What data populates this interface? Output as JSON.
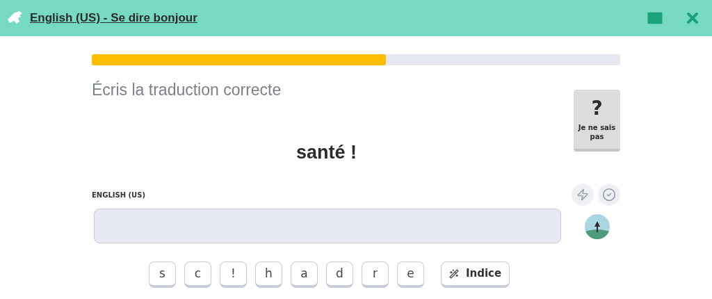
{
  "header": {
    "title": "English (US) - Se dire bonjour"
  },
  "progress": {
    "level": 0.557
  },
  "instruction": "Écris la traduction correcte",
  "prompt": "santé !",
  "answer": {
    "label": "ENGLISH (US)"
  },
  "skip_button": {
    "icon": "?",
    "label": "Je ne sais pas"
  },
  "letters": [
    "s",
    "c",
    "!",
    "h",
    "a",
    "d",
    "r",
    "e"
  ],
  "hint_button": {
    "label": "Indice"
  }
}
